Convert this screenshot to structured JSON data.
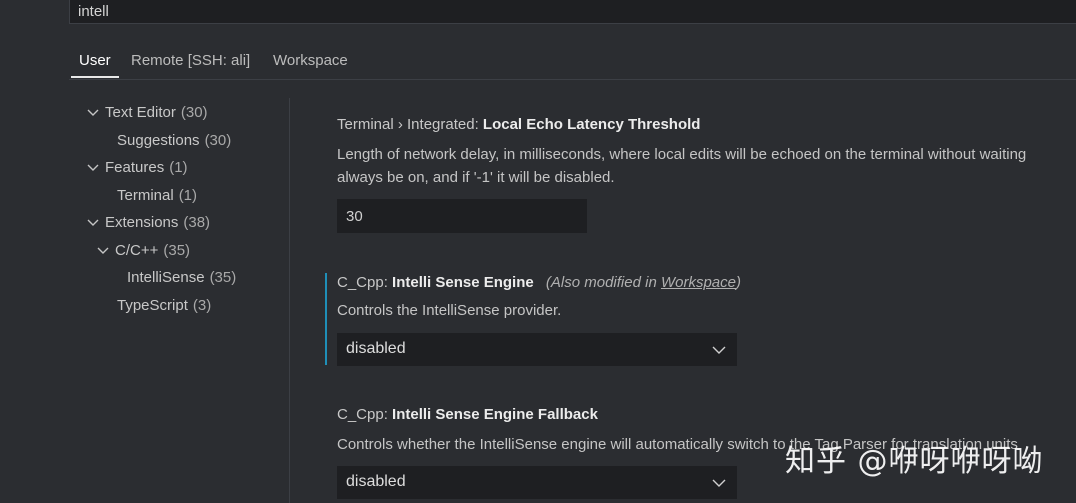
{
  "search": {
    "value": "intell"
  },
  "tabs": [
    {
      "label": "User",
      "active": true
    },
    {
      "label": "Remote [SSH: ali]",
      "active": false
    },
    {
      "label": "Workspace",
      "active": false
    }
  ],
  "tree": [
    {
      "label": "Text Editor",
      "count": "(30)",
      "expanded": true
    },
    {
      "label": "Suggestions",
      "count": "(30)"
    },
    {
      "label": "Features",
      "count": "(1)",
      "expanded": true
    },
    {
      "label": "Terminal",
      "count": "(1)"
    },
    {
      "label": "Extensions",
      "count": "(38)",
      "expanded": true
    },
    {
      "label": "C/C++",
      "count": "(35)",
      "expanded": true
    },
    {
      "label": "IntelliSense",
      "count": "(35)"
    },
    {
      "label": "TypeScript",
      "count": "(3)"
    }
  ],
  "settings": [
    {
      "category": "Terminal › Integrated: ",
      "name": "Local Echo Latency Threshold",
      "description_lines": [
        "Length of network delay, in milliseconds, where local edits will be echoed on the terminal without waiting",
        "always be on, and if '-1' it will be disabled."
      ],
      "value": "30"
    },
    {
      "category": "C_Cpp: ",
      "name": "Intelli Sense Engine",
      "modified_prefix": "(Also modified in ",
      "modified_link": "Workspace",
      "modified_suffix": ")",
      "description": "Controls the IntelliSense provider.",
      "value": "disabled"
    },
    {
      "category": "C_Cpp: ",
      "name": "Intelli Sense Engine Fallback",
      "description": "Controls whether the IntelliSense engine will automatically switch to the Tag Parser for translation units",
      "value": "disabled"
    }
  ],
  "watermark": "知乎 @咿呀咿呀呦",
  "colors": {
    "background": "#2b2d31",
    "input_background": "#1e1f22",
    "modified_indicator": "#1f8fb8"
  },
  "icons": {
    "expanded": "chevron-down-icon"
  }
}
